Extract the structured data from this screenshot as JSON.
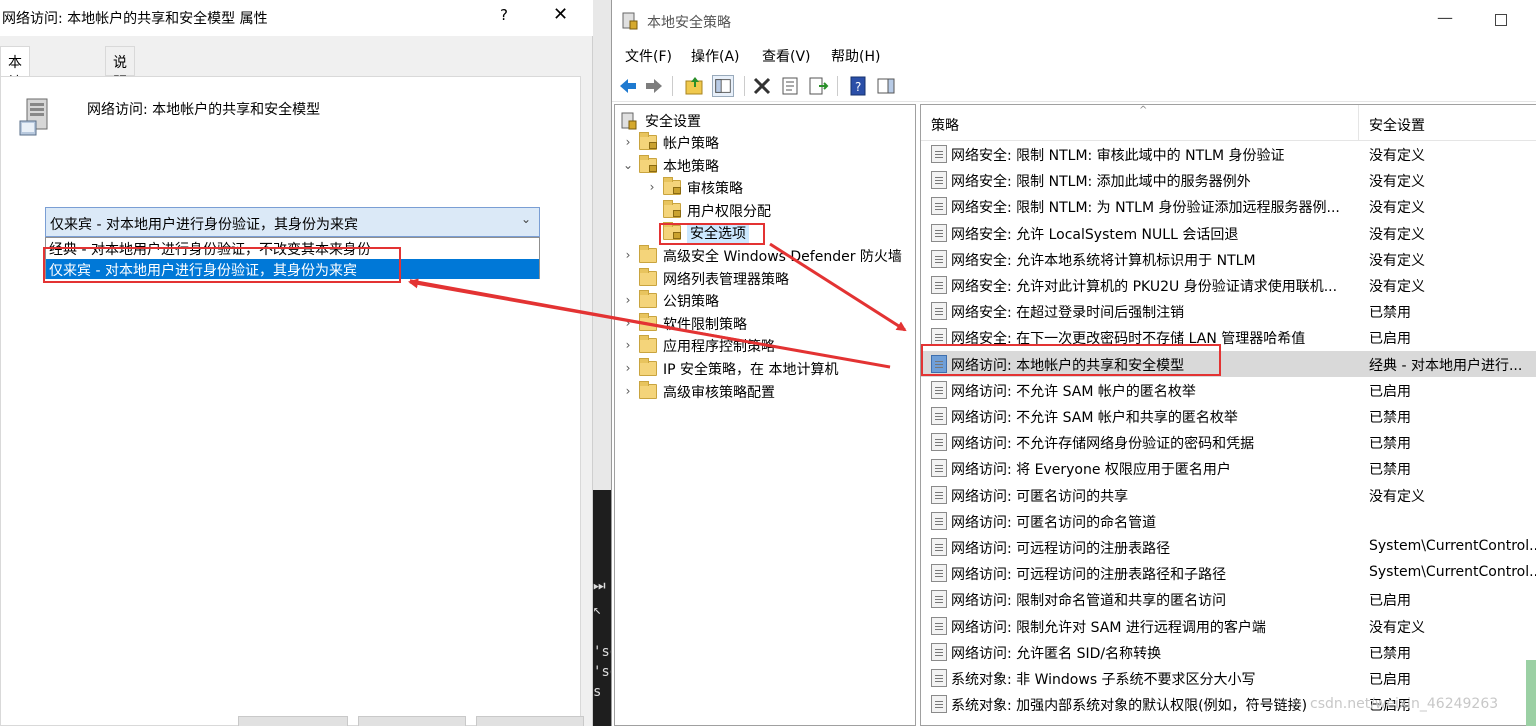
{
  "dialog": {
    "title": "网络访问: 本地帐户的共享和安全模型 属性",
    "help_glyph": "?",
    "close_glyph": "✕",
    "tabs": [
      {
        "label": "本地安全设置",
        "active": true
      },
      {
        "label": "说明",
        "active": false
      }
    ],
    "policy_name": "网络访问: 本地帐户的共享和安全模型",
    "combo_value": "仅来宾 - 对本地用户进行身份验证，其身份为来宾",
    "options": [
      "经典 - 对本地用户进行身份验证，不改变其本来身份",
      "仅来宾 - 对本地用户进行身份验证，其身份为来宾"
    ],
    "selected_option_index": 1
  },
  "mmc": {
    "title": "本地安全策略",
    "menu": [
      "文件(F)",
      "操作(A)",
      "查看(V)",
      "帮助(H)"
    ],
    "tree": {
      "root": "安全设置",
      "items": [
        {
          "label": "帐户策略",
          "level": 1,
          "expander": "›"
        },
        {
          "label": "本地策略",
          "level": 1,
          "expander": "⌄"
        },
        {
          "label": "审核策略",
          "level": 2,
          "expander": "›"
        },
        {
          "label": "用户权限分配",
          "level": 2,
          "expander": ""
        },
        {
          "label": "安全选项",
          "level": 2,
          "expander": "",
          "selected": true
        },
        {
          "label": "高级安全 Windows Defender 防火墙",
          "level": 1,
          "expander": "›"
        },
        {
          "label": "网络列表管理器策略",
          "level": 1,
          "expander": ""
        },
        {
          "label": "公钥策略",
          "level": 1,
          "expander": "›"
        },
        {
          "label": "软件限制策略",
          "level": 1,
          "expander": "›"
        },
        {
          "label": "应用程序控制策略",
          "level": 1,
          "expander": "›"
        },
        {
          "label": "IP 安全策略，在 本地计算机",
          "level": 1,
          "expander": "›"
        },
        {
          "label": "高级审核策略配置",
          "level": 1,
          "expander": "›"
        }
      ]
    },
    "list": {
      "columns": {
        "policy": "策略",
        "setting": "安全设置"
      },
      "rows": [
        {
          "policy": "网络安全: 限制 NTLM: 审核此域中的 NTLM 身份验证",
          "setting": "没有定义"
        },
        {
          "policy": "网络安全: 限制 NTLM: 添加此域中的服务器例外",
          "setting": "没有定义"
        },
        {
          "policy": "网络安全: 限制 NTLM: 为 NTLM 身份验证添加远程服务器例...",
          "setting": "没有定义"
        },
        {
          "policy": "网络安全: 允许 LocalSystem NULL 会话回退",
          "setting": "没有定义"
        },
        {
          "policy": "网络安全: 允许本地系统将计算机标识用于 NTLM",
          "setting": "没有定义"
        },
        {
          "policy": "网络安全: 允许对此计算机的 PKU2U 身份验证请求使用联机...",
          "setting": "没有定义"
        },
        {
          "policy": "网络安全: 在超过登录时间后强制注销",
          "setting": "已禁用"
        },
        {
          "policy": "网络安全: 在下一次更改密码时不存储 LAN 管理器哈希值",
          "setting": "已启用"
        },
        {
          "policy": "网络访问: 本地帐户的共享和安全模型",
          "setting": "经典 - 对本地用户进行...",
          "highlight": true
        },
        {
          "policy": "网络访问: 不允许 SAM 帐户的匿名枚举",
          "setting": "已启用"
        },
        {
          "policy": "网络访问: 不允许 SAM 帐户和共享的匿名枚举",
          "setting": "已禁用"
        },
        {
          "policy": "网络访问: 不允许存储网络身份验证的密码和凭据",
          "setting": "已禁用"
        },
        {
          "policy": "网络访问: 将 Everyone 权限应用于匿名用户",
          "setting": "已禁用"
        },
        {
          "policy": "网络访问: 可匿名访问的共享",
          "setting": "没有定义"
        },
        {
          "policy": "网络访问: 可匿名访问的命名管道",
          "setting": ""
        },
        {
          "policy": "网络访问: 可远程访问的注册表路径",
          "setting": "System\\CurrentControl..."
        },
        {
          "policy": "网络访问: 可远程访问的注册表路径和子路径",
          "setting": "System\\CurrentControl..."
        },
        {
          "policy": "网络访问: 限制对命名管道和共享的匿名访问",
          "setting": "已启用"
        },
        {
          "policy": "网络访问: 限制允许对 SAM 进行远程调用的客户端",
          "setting": "没有定义"
        },
        {
          "policy": "网络访问: 允许匿名 SID/名称转换",
          "setting": "已禁用"
        },
        {
          "policy": "系统对象: 非 Windows 子系统不要求区分大小写",
          "setting": "已启用"
        },
        {
          "policy": "系统对象: 加强内部系统对象的默认权限(例如，符号链接)",
          "setting": "已启用"
        }
      ]
    }
  },
  "background": {
    "terminal_glyphs": [
      "⏭",
      "↖",
      "'so",
      "'so",
      "s"
    ]
  },
  "watermark": "csdn.net/weixin_46249263",
  "colors": {
    "annotation_red": "#e33333",
    "selection_blue": "#0078d7",
    "highlight_gray": "#d9d9d9"
  }
}
